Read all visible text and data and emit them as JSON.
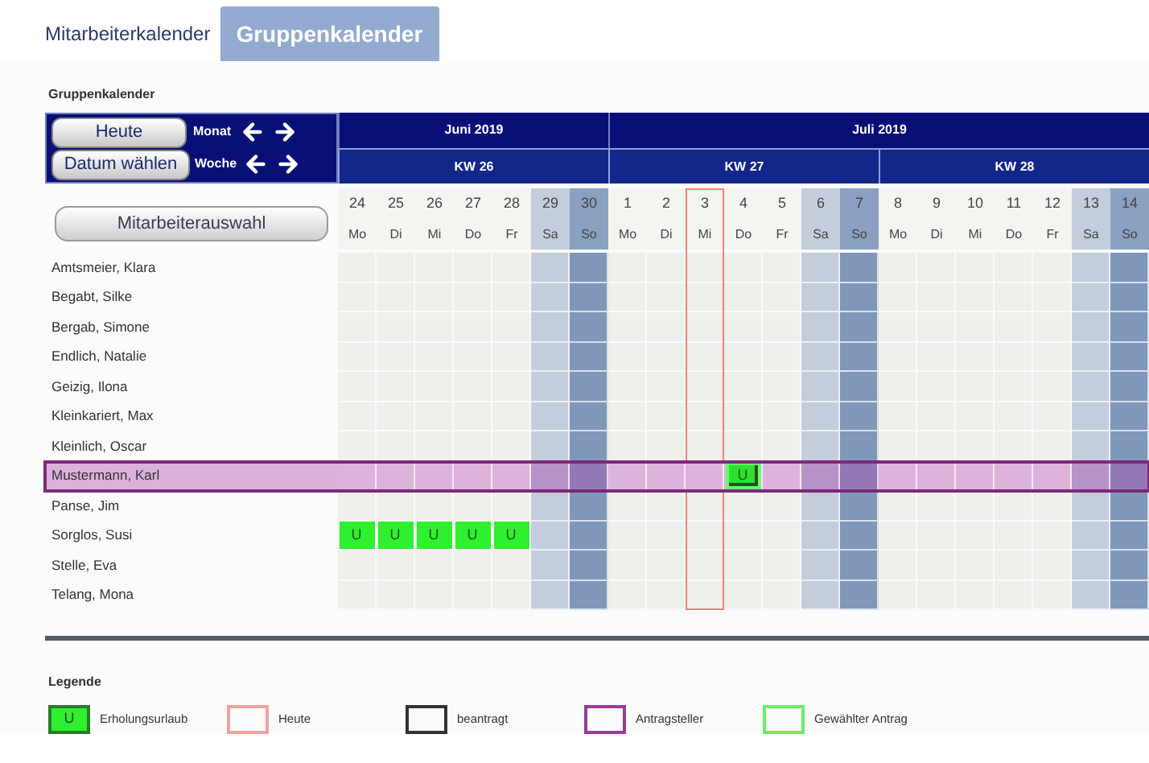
{
  "tabs": [
    {
      "label": "Mitarbeiterkalender",
      "selected": false
    },
    {
      "label": "Gruppenkalender",
      "selected": true
    }
  ],
  "heading": "Gruppenkalender",
  "nav": {
    "today_button": "Heute",
    "date_button": "Datum wählen",
    "month_label": "Monat",
    "week_label": "Woche"
  },
  "employee_button": "Mitarbeiterauswahl",
  "months": [
    {
      "label": "Juni 2019",
      "weeks": [
        {
          "label": "KW 26",
          "days": [
            {
              "num": "24",
              "weekday": "Mo",
              "kind": "weekday",
              "today": false
            },
            {
              "num": "25",
              "weekday": "Di",
              "kind": "weekday",
              "today": false
            },
            {
              "num": "26",
              "weekday": "Mi",
              "kind": "weekday",
              "today": false
            },
            {
              "num": "27",
              "weekday": "Do",
              "kind": "weekday",
              "today": false
            },
            {
              "num": "28",
              "weekday": "Fr",
              "kind": "weekday",
              "today": false
            },
            {
              "num": "29",
              "weekday": "Sa",
              "kind": "saturday",
              "today": false
            },
            {
              "num": "30",
              "weekday": "So",
              "kind": "sunday",
              "today": false
            }
          ]
        }
      ]
    },
    {
      "label": "Juli 2019",
      "weeks": [
        {
          "label": "KW 27",
          "days": [
            {
              "num": "1",
              "weekday": "Mo",
              "kind": "weekday",
              "today": false
            },
            {
              "num": "2",
              "weekday": "Di",
              "kind": "weekday",
              "today": false
            },
            {
              "num": "3",
              "weekday": "Mi",
              "kind": "weekday",
              "today": true
            },
            {
              "num": "4",
              "weekday": "Do",
              "kind": "weekday",
              "today": false
            },
            {
              "num": "5",
              "weekday": "Fr",
              "kind": "weekday",
              "today": false
            },
            {
              "num": "6",
              "weekday": "Sa",
              "kind": "saturday",
              "today": false
            },
            {
              "num": "7",
              "weekday": "So",
              "kind": "sunday",
              "today": false
            }
          ]
        },
        {
          "label": "KW 28",
          "days": [
            {
              "num": "8",
              "weekday": "Mo",
              "kind": "weekday",
              "today": false
            },
            {
              "num": "9",
              "weekday": "Di",
              "kind": "weekday",
              "today": false
            },
            {
              "num": "10",
              "weekday": "Mi",
              "kind": "weekday",
              "today": false
            },
            {
              "num": "11",
              "weekday": "Do",
              "kind": "weekday",
              "today": false
            },
            {
              "num": "12",
              "weekday": "Fr",
              "kind": "weekday",
              "today": false
            },
            {
              "num": "13",
              "weekday": "Sa",
              "kind": "saturday",
              "today": false
            },
            {
              "num": "14",
              "weekday": "So",
              "kind": "sunday",
              "today": false
            }
          ]
        }
      ]
    }
  ],
  "employees": [
    {
      "name": "Amtsmeier, Klara",
      "selected": false,
      "cells": [
        null,
        null,
        null,
        null,
        null,
        null,
        null,
        null,
        null,
        null,
        null,
        null,
        null,
        null,
        null,
        null,
        null,
        null,
        null,
        null,
        null
      ]
    },
    {
      "name": "Begabt, Silke",
      "selected": false,
      "cells": [
        null,
        null,
        null,
        null,
        null,
        null,
        null,
        null,
        null,
        null,
        null,
        null,
        null,
        null,
        null,
        null,
        null,
        null,
        null,
        null,
        null
      ]
    },
    {
      "name": "Bergab, Simone",
      "selected": false,
      "cells": [
        null,
        null,
        null,
        null,
        null,
        null,
        null,
        null,
        null,
        null,
        null,
        null,
        null,
        null,
        null,
        null,
        null,
        null,
        null,
        null,
        null
      ]
    },
    {
      "name": "Endlich, Natalie",
      "selected": false,
      "cells": [
        null,
        null,
        null,
        null,
        null,
        null,
        null,
        null,
        null,
        null,
        null,
        null,
        null,
        null,
        null,
        null,
        null,
        null,
        null,
        null,
        null
      ]
    },
    {
      "name": "Geizig, Ilona",
      "selected": false,
      "cells": [
        null,
        null,
        null,
        null,
        null,
        null,
        null,
        null,
        null,
        null,
        null,
        null,
        null,
        null,
        null,
        null,
        null,
        null,
        null,
        null,
        null
      ]
    },
    {
      "name": "Kleinkariert, Max",
      "selected": false,
      "cells": [
        null,
        null,
        null,
        null,
        null,
        null,
        null,
        null,
        null,
        null,
        null,
        null,
        null,
        null,
        null,
        null,
        null,
        null,
        null,
        null,
        null
      ]
    },
    {
      "name": "Kleinlich, Oscar",
      "selected": false,
      "cells": [
        null,
        null,
        null,
        null,
        null,
        null,
        null,
        null,
        null,
        null,
        null,
        null,
        null,
        null,
        null,
        null,
        null,
        null,
        null,
        null,
        null
      ]
    },
    {
      "name": "Mustermann, Karl",
      "selected": true,
      "cells": [
        null,
        null,
        null,
        null,
        null,
        null,
        null,
        null,
        null,
        null,
        {
          "label": "U",
          "kind": "requested"
        },
        null,
        null,
        null,
        null,
        null,
        null,
        null,
        null,
        null,
        null
      ]
    },
    {
      "name": "Panse, Jim",
      "selected": false,
      "cells": [
        null,
        null,
        null,
        null,
        null,
        null,
        null,
        null,
        null,
        null,
        null,
        null,
        null,
        null,
        null,
        null,
        null,
        null,
        null,
        null,
        null
      ]
    },
    {
      "name": "Sorglos, Susi",
      "selected": false,
      "cells": [
        {
          "label": "U",
          "kind": "approved"
        },
        {
          "label": "U",
          "kind": "approved"
        },
        {
          "label": "U",
          "kind": "approved"
        },
        {
          "label": "U",
          "kind": "approved"
        },
        {
          "label": "U",
          "kind": "approved"
        },
        null,
        null,
        null,
        null,
        null,
        null,
        null,
        null,
        null,
        null,
        null,
        null,
        null,
        null,
        null,
        null
      ]
    },
    {
      "name": "Stelle, Eva",
      "selected": false,
      "cells": [
        null,
        null,
        null,
        null,
        null,
        null,
        null,
        null,
        null,
        null,
        null,
        null,
        null,
        null,
        null,
        null,
        null,
        null,
        null,
        null,
        null
      ]
    },
    {
      "name": "Telang, Mona",
      "selected": false,
      "cells": [
        null,
        null,
        null,
        null,
        null,
        null,
        null,
        null,
        null,
        null,
        null,
        null,
        null,
        null,
        null,
        null,
        null,
        null,
        null,
        null,
        null
      ]
    }
  ],
  "legend": {
    "title": "Legende",
    "items": [
      {
        "kind": "vacation",
        "swatch_label": "U",
        "label": "Erholungsurlaub"
      },
      {
        "kind": "today",
        "label": "Heute"
      },
      {
        "kind": "requested",
        "label": "beantragt"
      },
      {
        "kind": "applicant",
        "label": "Antragsteller"
      },
      {
        "kind": "selected",
        "label": "Gewählter Antrag"
      }
    ]
  }
}
